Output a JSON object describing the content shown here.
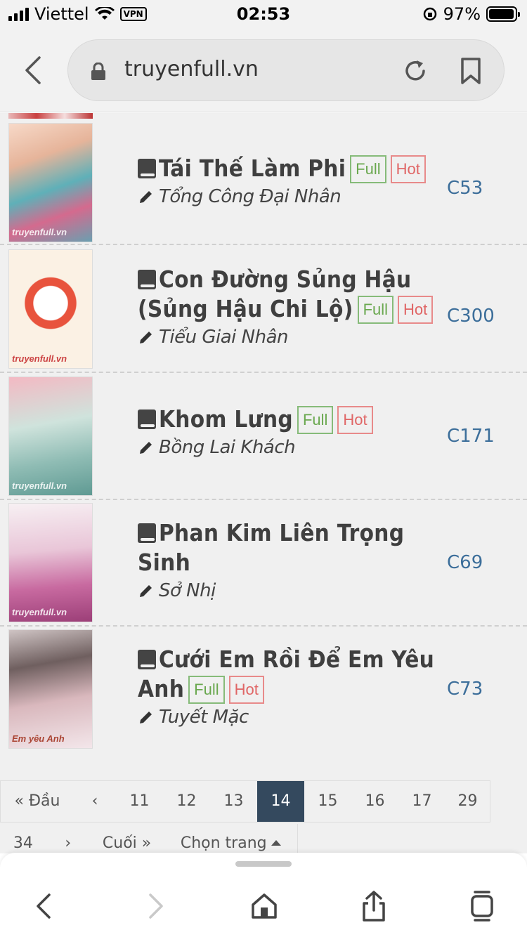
{
  "status": {
    "carrier": "Viettel",
    "vpn": "VPN",
    "time": "02:53",
    "battery": "97%",
    "battery_level": 0.97
  },
  "browser": {
    "url": "truyenfull.vn"
  },
  "stories": [
    {
      "title": "Tái Thế Làm Phi",
      "author": "Tổng Công Đại Nhân",
      "chapter": "C53",
      "full": "Full",
      "hot": "Hot"
    },
    {
      "title": "Con Đường Sủng Hậu (Sủng Hậu Chi Lộ)",
      "author": "Tiểu Giai Nhân",
      "chapter": "C300",
      "full": "Full",
      "hot": "Hot"
    },
    {
      "title": "Khom Lưng",
      "author": "Bồng Lai Khách",
      "chapter": "C171",
      "full": "Full",
      "hot": "Hot"
    },
    {
      "title": "Phan Kim Liên Trọng Sinh",
      "author": "Sở Nhị",
      "chapter": "C69"
    },
    {
      "title": "Cưới Em Rồi Để Em Yêu Anh",
      "author": "Tuyết Mặc",
      "chapter": "C73",
      "full": "Full",
      "hot": "Hot"
    }
  ],
  "pagination": {
    "first": "« Đầu",
    "prev": "‹",
    "pages": [
      "11",
      "12",
      "13",
      "14",
      "15",
      "16",
      "17",
      "29"
    ],
    "current": "14",
    "row2_page": "34",
    "next": "›",
    "last": "Cuối »",
    "choose": "Chọn trang"
  },
  "colors": {
    "full_label": "#6aa84f",
    "hot_label": "#e06666",
    "chapter_link": "#3c6e9a",
    "active_page": "#34495e"
  },
  "icons": [
    "back-chevron-icon",
    "lock-icon",
    "reload-icon",
    "bookmark-icon",
    "book-icon",
    "pencil-icon",
    "share-icon",
    "home-icon",
    "tabs-icon"
  ]
}
